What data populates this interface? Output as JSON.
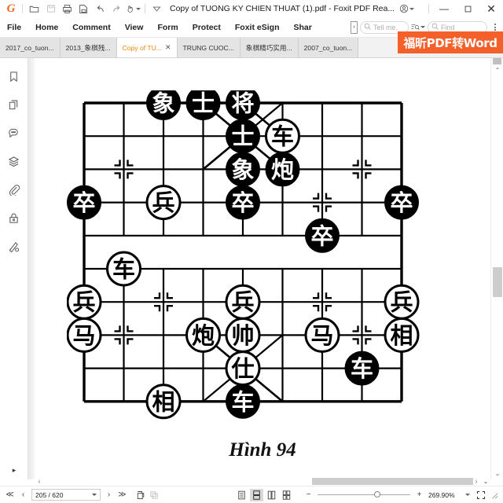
{
  "window": {
    "title": "Copy of TUONG KY CHIEN THUAT (1).pdf - Foxit PDF Rea...",
    "logo": "foxit-g-logo",
    "quick_access": [
      {
        "name": "open-file-icon",
        "label": "Open"
      },
      {
        "name": "save-icon",
        "label": "Save"
      },
      {
        "name": "print-icon",
        "label": "Print"
      },
      {
        "name": "email-icon",
        "label": "Email"
      },
      {
        "name": "undo-icon",
        "label": "Undo"
      },
      {
        "name": "redo-icon",
        "label": "Redo"
      },
      {
        "name": "hand-tool-icon",
        "label": "Hand Tool"
      }
    ],
    "customize_caret": "customize-quick-access",
    "account_label": "account",
    "minimize": "—",
    "maximize": "☐",
    "close": "✕"
  },
  "ribbon": {
    "tabs": [
      {
        "label": "File"
      },
      {
        "label": "Home"
      },
      {
        "label": "Comment"
      },
      {
        "label": "View"
      },
      {
        "label": "Form"
      },
      {
        "label": "Protect"
      },
      {
        "label": "Foxit eSign"
      },
      {
        "label": "Shar"
      }
    ],
    "tell_me_placeholder": "Tell me.",
    "find_placeholder": "Find",
    "overflow_label": "›"
  },
  "tabbar": {
    "tabs": [
      {
        "label": "2017_co_tuon...",
        "active": false,
        "closable": false
      },
      {
        "label": "2013_象棋残...",
        "active": false,
        "closable": false
      },
      {
        "label": "Copy of TU...",
        "active": true,
        "closable": true,
        "close": "✕"
      },
      {
        "label": "TRUNG CUOC...",
        "active": false,
        "closable": false
      },
      {
        "label": "象棋精巧实用...",
        "active": false,
        "closable": false
      },
      {
        "label": "2007_co_tuon...",
        "active": false,
        "closable": false
      }
    ],
    "more_label": "▾",
    "watermark": "福昕PDF转Word"
  },
  "sidebar": {
    "items": [
      {
        "name": "bookmark-icon",
        "label": "Bookmarks"
      },
      {
        "name": "page-thumbnails-icon",
        "label": "Page Thumbnails"
      },
      {
        "name": "comments-icon",
        "label": "Comments"
      },
      {
        "name": "layers-icon",
        "label": "Layers"
      },
      {
        "name": "attachments-icon",
        "label": "Attachments"
      },
      {
        "name": "security-icon",
        "label": "Security"
      },
      {
        "name": "signature-icon",
        "label": "Digital Signatures"
      }
    ],
    "expand_label": "▸"
  },
  "document": {
    "caption": "Hình 94",
    "board": {
      "type": "xiangqi-diagram",
      "files": 9,
      "ranks": 10,
      "black_color": "#000000",
      "red_color": "#ffffff",
      "pieces": [
        {
          "glyph": "象",
          "side": "black",
          "file": 2,
          "rank": 0
        },
        {
          "glyph": "士",
          "side": "black",
          "file": 3,
          "rank": 0
        },
        {
          "glyph": "将",
          "side": "black",
          "file": 4,
          "rank": 0
        },
        {
          "glyph": "士",
          "side": "black",
          "file": 4,
          "rank": 1
        },
        {
          "glyph": "车",
          "side": "red",
          "file": 5,
          "rank": 1
        },
        {
          "glyph": "象",
          "side": "black",
          "file": 4,
          "rank": 2
        },
        {
          "glyph": "炮",
          "side": "black",
          "file": 5,
          "rank": 2
        },
        {
          "glyph": "卒",
          "side": "black",
          "file": 0,
          "rank": 3
        },
        {
          "glyph": "兵",
          "side": "red",
          "file": 2,
          "rank": 3
        },
        {
          "glyph": "卒",
          "side": "black",
          "file": 4,
          "rank": 3
        },
        {
          "glyph": "卒",
          "side": "black",
          "file": 8,
          "rank": 3
        },
        {
          "glyph": "卒",
          "side": "black",
          "file": 6,
          "rank": 4
        },
        {
          "glyph": "车",
          "side": "red",
          "file": 1,
          "rank": 5
        },
        {
          "glyph": "兵",
          "side": "red",
          "file": 0,
          "rank": 6
        },
        {
          "glyph": "兵",
          "side": "red",
          "file": 4,
          "rank": 6
        },
        {
          "glyph": "兵",
          "side": "red",
          "file": 8,
          "rank": 6
        },
        {
          "glyph": "马",
          "side": "red",
          "file": 0,
          "rank": 7
        },
        {
          "glyph": "炮",
          "side": "red",
          "file": 3,
          "rank": 7
        },
        {
          "glyph": "帅",
          "side": "red",
          "file": 4,
          "rank": 7
        },
        {
          "glyph": "马",
          "side": "red",
          "file": 6,
          "rank": 7
        },
        {
          "glyph": "相",
          "side": "red",
          "file": 8,
          "rank": 7
        },
        {
          "glyph": "仕",
          "side": "red",
          "file": 4,
          "rank": 8
        },
        {
          "glyph": "车",
          "side": "black",
          "file": 7,
          "rank": 8
        },
        {
          "glyph": "相",
          "side": "red",
          "file": 2,
          "rank": 9
        },
        {
          "glyph": "车",
          "side": "black",
          "file": 4,
          "rank": 9
        }
      ],
      "arrows": [
        {
          "from_file": 3,
          "from_rank": 0,
          "to_file": 4,
          "to_rank": 1
        },
        {
          "from_file": 4,
          "from_rank": 0,
          "to_file": 5,
          "to_rank": 1
        },
        {
          "from_file": 4,
          "from_rank": 1,
          "to_file": 3,
          "to_rank": 2
        },
        {
          "from_file": 4,
          "from_rank": 1,
          "to_file": 5,
          "to_rank": 2
        },
        {
          "from_file": 4,
          "from_rank": 7,
          "to_file": 4,
          "to_rank": 8
        },
        {
          "from_file": 4,
          "from_rank": 8,
          "to_file": 4,
          "to_rank": 9
        },
        {
          "from_file": 4,
          "from_rank": 8,
          "to_file": 5,
          "to_rank": 9
        },
        {
          "from_file": 3,
          "from_rank": 7,
          "to_file": 4,
          "to_rank": 8
        }
      ]
    }
  },
  "statusbar": {
    "first_page": "≪",
    "prev_page": "‹",
    "page_value": "205 / 620",
    "next_page": "›",
    "last_page": "≫",
    "tools": [
      {
        "name": "snapshot-icon",
        "label": "Snapshot"
      },
      {
        "name": "copy-icon",
        "label": "Copy"
      }
    ],
    "view_modes": [
      {
        "name": "single-page-view",
        "active": false
      },
      {
        "name": "continuous-view",
        "active": true
      },
      {
        "name": "facing-view",
        "active": false
      },
      {
        "name": "facing-continuous-view",
        "active": false
      }
    ],
    "zoom_out": "−",
    "zoom_in": "+",
    "zoom_value": "269.90%",
    "fit_label": "fullscreen"
  },
  "scrollbars": {
    "v_up": "⌃",
    "v_down": "⌄",
    "h_left": "‹",
    "h_right": "›"
  }
}
